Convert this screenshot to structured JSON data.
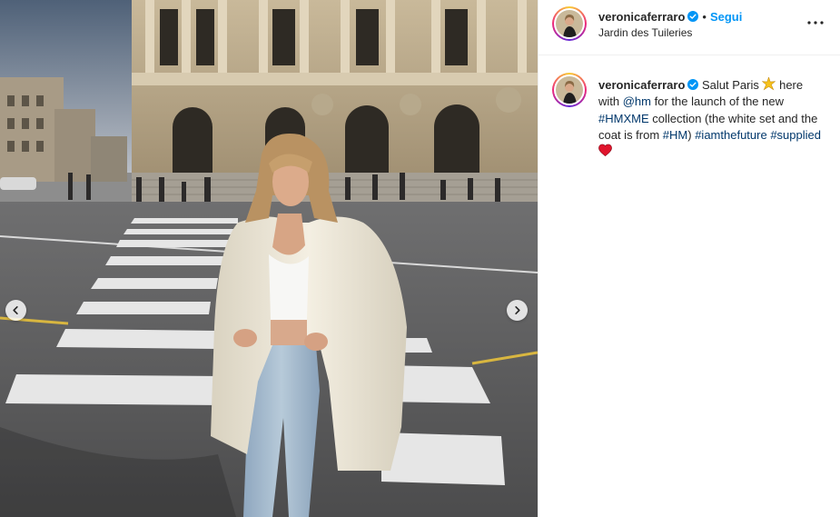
{
  "post": {
    "username": "veronicaferraro",
    "follow_label": "Segui",
    "separator": "•",
    "location": "Jardin des Tuileries",
    "more_icon": "more-horizontal-icon"
  },
  "caption": {
    "username": "veronicaferraro",
    "text_1": " Salut Paris ",
    "text_2": " here with ",
    "mention_hm": "@hm",
    "text_3": " for the launch of the new ",
    "hashtag_hmxme": "#HMXME",
    "text_4": " collection (the white set and the coat is from ",
    "hashtag_hm": "#HM",
    "text_5": ") ",
    "hashtag_future": "#iamthefuture",
    "hashtag_supplied": "#supplied",
    "emoji_1": "sparkle-icon",
    "emoji_2": "heart-icon"
  },
  "carousel": {
    "prev_icon": "chevron-left-icon",
    "next_icon": "chevron-right-icon"
  },
  "colors": {
    "accent": "#0095f6",
    "link": "#00376b",
    "verified": "#0095f6",
    "heart": "#e0142c"
  }
}
